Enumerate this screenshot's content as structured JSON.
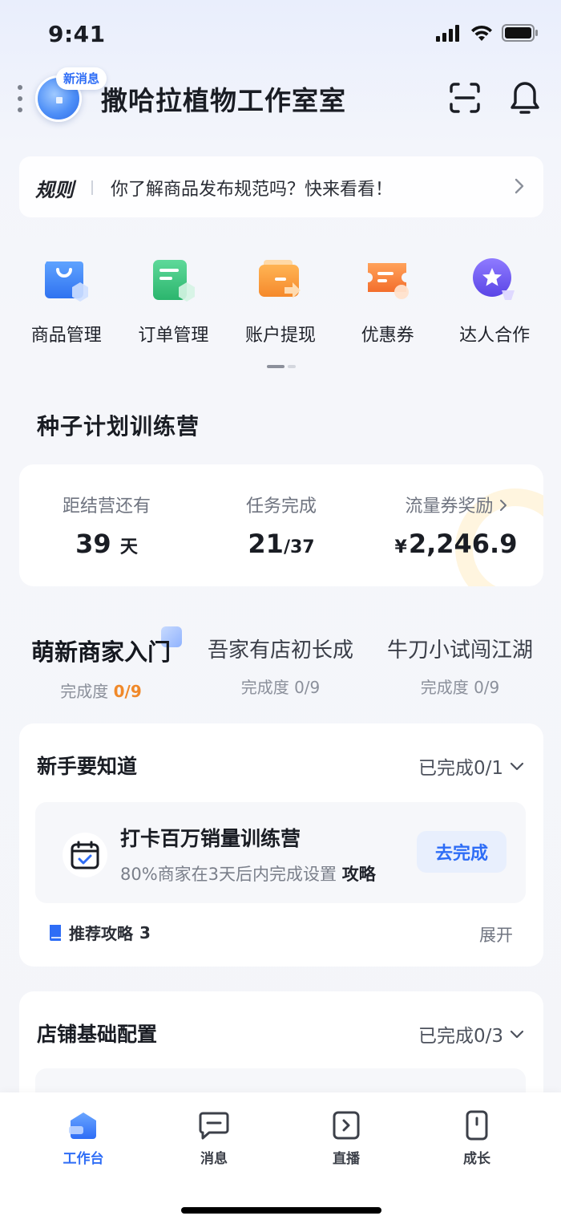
{
  "status_bar": {
    "time": "9:41"
  },
  "header": {
    "badge": "新消息",
    "shop_name": "撒哈拉植物工作室室"
  },
  "rules": {
    "tag": "规则",
    "text": "你了解商品发布规范吗？快来看看！"
  },
  "quick_menu": [
    {
      "label": "商品管理",
      "icon": "shopping-bag-icon"
    },
    {
      "label": "订单管理",
      "icon": "order-icon"
    },
    {
      "label": "账户提现",
      "icon": "wallet-icon"
    },
    {
      "label": "优惠券",
      "icon": "coupon-icon"
    },
    {
      "label": "达人合作",
      "icon": "star-icon"
    }
  ],
  "camp": {
    "title": "种子计划训练营",
    "stats": [
      {
        "label": "距结营还有",
        "value": "39",
        "unit": "天"
      },
      {
        "label": "任务完成",
        "value": "21",
        "unit": "/37"
      },
      {
        "label": "流量券奖励",
        "currency": "¥",
        "value": "2,246.9"
      }
    ]
  },
  "levels": [
    {
      "name": "萌新商家入门",
      "progress_label": "完成度",
      "progress": "0/9",
      "active": true
    },
    {
      "name": "吾家有店初长成",
      "progress_label": "完成度",
      "progress": "0/9",
      "active": false
    },
    {
      "name": "牛刀小试闯江湖",
      "progress_label": "完成度",
      "progress": "0/9",
      "active": false
    }
  ],
  "task_card": {
    "title": "新手要知道",
    "status": "已完成0/1",
    "task": {
      "name": "打卡百万销量训练营",
      "desc": "80%商家在3天后内完成设置",
      "desc_link": "攻略",
      "button": "去完成"
    },
    "guide_label": "推荐攻略",
    "guide_count": "3",
    "expand": "展开"
  },
  "config_card": {
    "title": "店铺基础配置",
    "status": "已完成0/3"
  },
  "tabbar": [
    {
      "label": "工作台",
      "icon": "workbench-icon",
      "active": true
    },
    {
      "label": "消息",
      "icon": "message-icon",
      "active": false
    },
    {
      "label": "直播",
      "icon": "live-icon",
      "active": false
    },
    {
      "label": "成长",
      "icon": "growth-icon",
      "active": false
    }
  ],
  "colors": {
    "accent": "#2e6df6",
    "highlight": "#f0892a",
    "background": "#f4f5f9"
  }
}
